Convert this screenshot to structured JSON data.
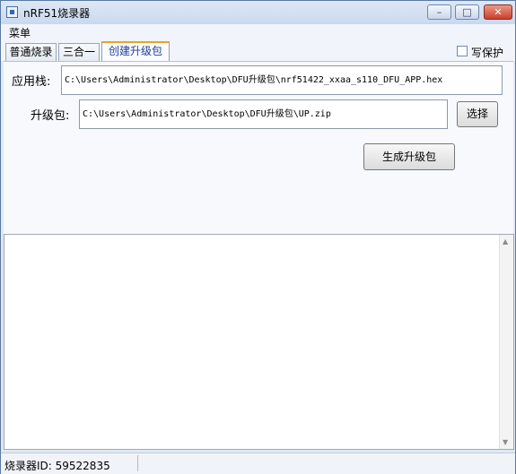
{
  "window": {
    "title": "nRF51烧录器",
    "min_icon": "minimize-icon",
    "max_icon": "maximize-icon",
    "close_icon": "close-icon"
  },
  "menubar": {
    "menu": "菜单"
  },
  "tabs": [
    {
      "label": "普通烧录"
    },
    {
      "label": "三合一"
    },
    {
      "label": "创建升级包"
    }
  ],
  "write_protect": {
    "label": "写保护",
    "checked": false
  },
  "form": {
    "app_stack_label": "应用栈:",
    "app_stack_value": "C:\\Users\\Administrator\\Desktop\\DFU升级包\\nrf51422_xxaa_s110_DFU_APP.hex",
    "package_label": "升级包:",
    "package_value": "C:\\Users\\Administrator\\Desktop\\DFU升级包\\UP.zip",
    "choose_label": "选择",
    "generate_label": "生成升级包"
  },
  "status": {
    "burner_id": "烧录器ID: 59522835"
  },
  "colors": {
    "active_tab_accent": "#e8a32a",
    "active_tab_text": "#1f3f9b",
    "close_button": "#c8402b"
  }
}
